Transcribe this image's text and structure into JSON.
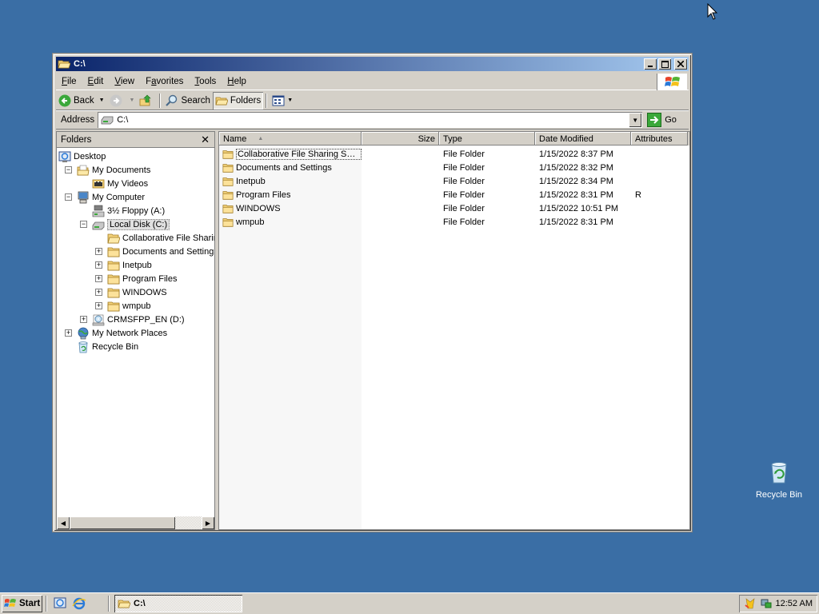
{
  "window": {
    "title": "C:\\",
    "menu": [
      {
        "label": "File",
        "key": "F",
        "rest": "ile"
      },
      {
        "label": "Edit",
        "key": "E",
        "rest": "dit"
      },
      {
        "label": "View",
        "key": "V",
        "rest": "iew"
      },
      {
        "label": "Favorites",
        "key": "a",
        "pre": "F",
        "rest": "vorites"
      },
      {
        "label": "Tools",
        "key": "T",
        "rest": "ools"
      },
      {
        "label": "Help",
        "key": "H",
        "rest": "elp"
      }
    ],
    "toolbar": {
      "back_label": "Back",
      "search_label": "Search",
      "folders_label": "Folders"
    },
    "address": {
      "label": "Address",
      "value": "C:\\",
      "go_label": "Go"
    }
  },
  "folders_pane": {
    "title": "Folders",
    "close_label": "✕",
    "tree": [
      {
        "label": "Desktop",
        "icon": "desktop-icon",
        "level": 0,
        "expander": ""
      },
      {
        "label": "My Documents",
        "icon": "my-documents-icon",
        "level": 1,
        "expander": "−"
      },
      {
        "label": "My Videos",
        "icon": "my-videos-icon",
        "level": 2,
        "expander": ""
      },
      {
        "label": "My Computer",
        "icon": "my-computer-icon",
        "level": 1,
        "expander": "−"
      },
      {
        "label": "3½ Floppy (A:)",
        "icon": "floppy-icon",
        "level": 2,
        "expander": ""
      },
      {
        "label": "Local Disk (C:)",
        "icon": "local-disk-icon",
        "level": 2,
        "expander": "−",
        "selected": true
      },
      {
        "label": "Collaborative File Sharin",
        "icon": "folder-open-icon",
        "level": 3,
        "expander": ""
      },
      {
        "label": "Documents and Settings",
        "icon": "folder-icon",
        "level": 3,
        "expander": "+"
      },
      {
        "label": "Inetpub",
        "icon": "folder-icon",
        "level": 3,
        "expander": "+"
      },
      {
        "label": "Program Files",
        "icon": "folder-icon",
        "level": 3,
        "expander": "+"
      },
      {
        "label": "WINDOWS",
        "icon": "folder-icon",
        "level": 3,
        "expander": "+"
      },
      {
        "label": "wmpub",
        "icon": "folder-icon",
        "level": 3,
        "expander": "+"
      },
      {
        "label": "CRMSFPP_EN (D:)",
        "icon": "cd-drive-icon",
        "level": 2,
        "expander": "+"
      },
      {
        "label": "My Network Places",
        "icon": "network-places-icon",
        "level": 1,
        "expander": "+"
      },
      {
        "label": "Recycle Bin",
        "icon": "recycle-bin-icon",
        "level": 1,
        "expander": ""
      }
    ]
  },
  "file_list": {
    "columns": {
      "name": "Name",
      "size": "Size",
      "type": "Type",
      "date": "Date Modified",
      "attributes": "Attributes"
    },
    "rows": [
      {
        "name": "Collaborative File Sharing Ser...",
        "size": "",
        "type": "File Folder",
        "date": "1/15/2022 8:37 PM",
        "attributes": ""
      },
      {
        "name": "Documents and Settings",
        "size": "",
        "type": "File Folder",
        "date": "1/15/2022 8:32 PM",
        "attributes": ""
      },
      {
        "name": "Inetpub",
        "size": "",
        "type": "File Folder",
        "date": "1/15/2022 8:34 PM",
        "attributes": ""
      },
      {
        "name": "Program Files",
        "size": "",
        "type": "File Folder",
        "date": "1/15/2022 8:31 PM",
        "attributes": "R"
      },
      {
        "name": "WINDOWS",
        "size": "",
        "type": "File Folder",
        "date": "1/15/2022 10:51 PM",
        "attributes": ""
      },
      {
        "name": "wmpub",
        "size": "",
        "type": "File Folder",
        "date": "1/15/2022 8:31 PM",
        "attributes": ""
      }
    ]
  },
  "desktop": {
    "recycle_bin_label": "Recycle Bin"
  },
  "taskbar": {
    "start_label": "Start",
    "task_label": "C:\\",
    "clock": "12:52 AM"
  }
}
